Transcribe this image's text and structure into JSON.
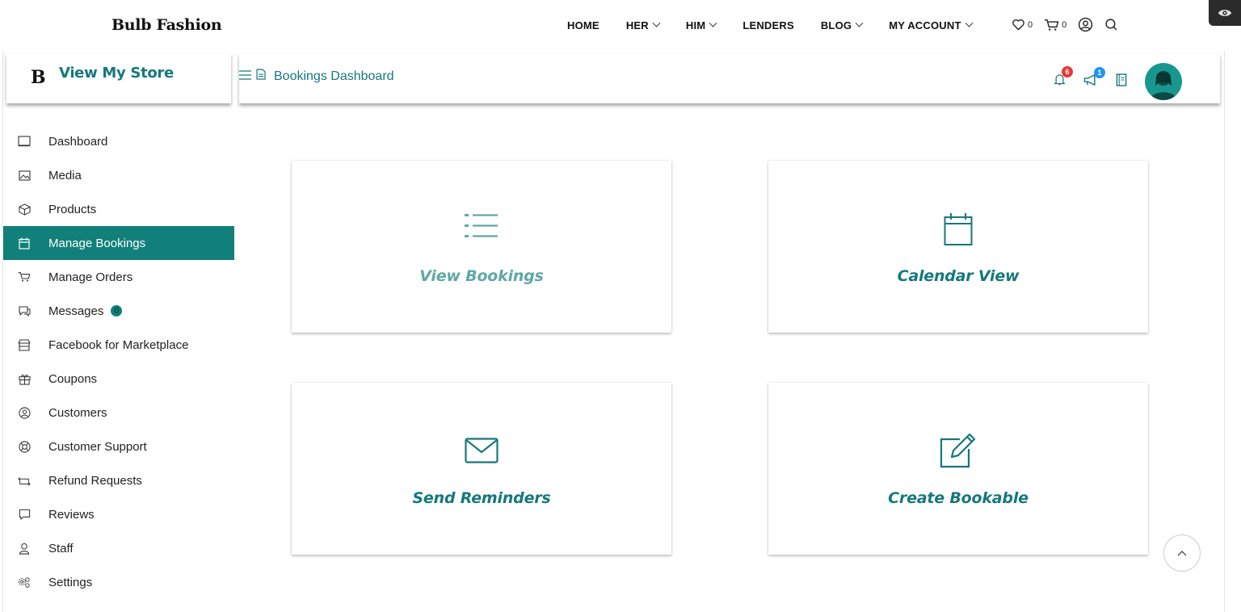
{
  "site": {
    "brand": "Bulb Fashion",
    "nav": [
      {
        "label": "HOME",
        "dropdown": false
      },
      {
        "label": "HER",
        "dropdown": true
      },
      {
        "label": "HIM",
        "dropdown": true
      },
      {
        "label": "LENDERS",
        "dropdown": false
      },
      {
        "label": "BLOG",
        "dropdown": true
      },
      {
        "label": "MY ACCOUNT",
        "dropdown": true
      }
    ],
    "wishlist_count": "0",
    "cart_count": "0",
    "icons": [
      "heart-icon",
      "cart-icon",
      "user-icon",
      "search-icon",
      "eye-icon"
    ]
  },
  "store": {
    "logo_letter": "B",
    "name": "View My Store"
  },
  "topbar": {
    "breadcrumb": "Bookings Dashboard",
    "notifications_count": "6",
    "announcements_count": "1",
    "accent_color": "#12807a",
    "notification_badge_color": "#e53935",
    "announcement_badge_color": "#2196f3"
  },
  "sidebar": {
    "items": [
      {
        "label": "Dashboard",
        "icon": "monitor-icon"
      },
      {
        "label": "Media",
        "icon": "image-icon"
      },
      {
        "label": "Products",
        "icon": "cube-icon"
      },
      {
        "label": "Manage Bookings",
        "icon": "calendar-icon",
        "active": true
      },
      {
        "label": "Manage Orders",
        "icon": "cart-icon"
      },
      {
        "label": "Messages",
        "icon": "chat-icon",
        "count": "0"
      },
      {
        "label": "Facebook for Marketplace",
        "icon": "store-icon"
      },
      {
        "label": "Coupons",
        "icon": "gift-icon"
      },
      {
        "label": "Customers",
        "icon": "user-circle-icon"
      },
      {
        "label": "Customer Support",
        "icon": "lifebuoy-icon"
      },
      {
        "label": "Refund Requests",
        "icon": "refund-icon"
      },
      {
        "label": "Reviews",
        "icon": "comment-icon"
      },
      {
        "label": "Staff",
        "icon": "user-icon"
      },
      {
        "label": "Settings",
        "icon": "settings-icon"
      }
    ]
  },
  "cards": [
    {
      "label": "View Bookings",
      "icon": "list-icon"
    },
    {
      "label": "Calendar View",
      "icon": "calendar-icon"
    },
    {
      "label": "Send Reminders",
      "icon": "envelope-icon"
    },
    {
      "label": "Create Bookable",
      "icon": "edit-icon"
    }
  ]
}
